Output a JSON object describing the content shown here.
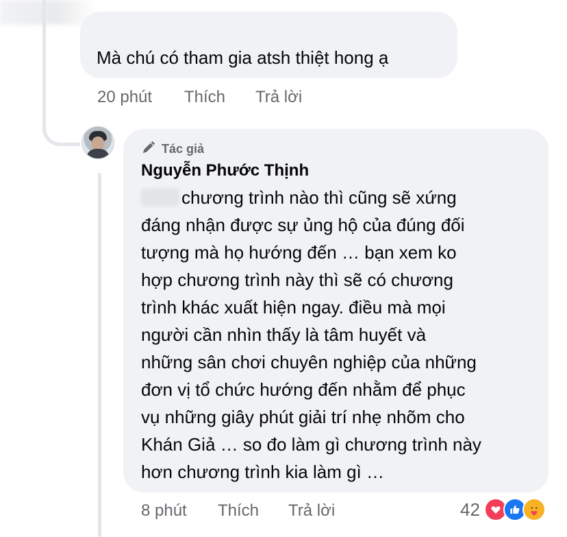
{
  "comment_1": {
    "text": "Mà chú có tham gia atsh thiệt hong ạ",
    "time": "20 phút",
    "like_label": "Thích",
    "reply_label": "Trả lời"
  },
  "reply": {
    "badge_icon": "pencil-icon",
    "badge_label": "Tác giả",
    "author": "Nguyễn Phước Thịnh",
    "lines": [
      "chương trình nào thì cũng sẽ xứng",
      "đáng nhận được sự ủng hộ của đúng đối",
      "tượng mà họ hướng đến … bạn xem ko",
      "hợp chương trình này thì sẽ có chương",
      "trình khác xuất hiện ngay. điều mà mọi",
      "người cần nhìn thấy là tâm huyết và",
      "những sân chơi chuyên nghiệp của những",
      "đơn vị tổ chức hướng đến nhằm để phục",
      "vụ những giây phút giải trí nhẹ nhõm cho",
      "Khán Giả … so đo làm gì chương trình này",
      "hơn chương trình kia làm gì …"
    ],
    "time": "8 phút",
    "like_label": "Thích",
    "reply_label": "Trả lời",
    "reaction_count": "42",
    "reactions": [
      "heart-icon",
      "like-icon",
      "care-icon"
    ]
  },
  "colors": {
    "bubble": "#f0f2f5",
    "meta_text": "#65676b",
    "love": "#f33e58",
    "like": "#1877f2",
    "care": "#f7b125"
  }
}
